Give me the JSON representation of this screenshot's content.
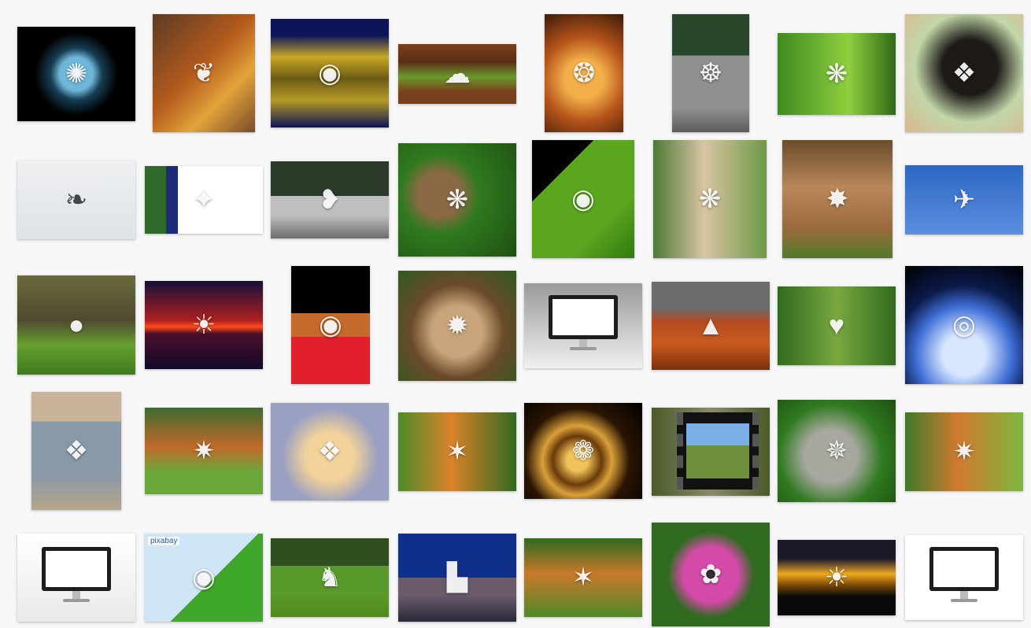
{
  "page": {
    "background": "#f7f7f7"
  },
  "browser_logo_text": "pixabay",
  "tiles": [
    {
      "name": "blue-skull-ornament-thumbnail",
      "icon": "ornament-icon",
      "bg": "radial-gradient(circle at 50% 50%, #6fb7d8 0 22%, #173f55 34%, #000 55%)"
    },
    {
      "name": "autumn-leaves-frame-thumbnail",
      "icon": "leaf-icon",
      "bg": "linear-gradient(135deg,#5b3b23,#b35a1c 45%,#e2a33a 70%,#7a4a2a)"
    },
    {
      "name": "frog-reflection-thumbnail",
      "icon": "frog-icon",
      "bg": "linear-gradient(#0b1457 0 15%, #c9a825 35%, #6b5a15 55%, #b79a26 75%, #0b1457 100%)"
    },
    {
      "name": "lamb-on-grass-thumbnail",
      "icon": "lamb-icon",
      "bg": "linear-gradient(#7a3f1c,#5a2e12 30%, #6a9a2c 55%, #7a3f1c 80%)"
    },
    {
      "name": "fractal-lion-thumbnail",
      "icon": "lion-icon",
      "bg": "radial-gradient(circle at 50% 55%, #f3b04a 0 25%, #b6541a 55%, #3b1a08)"
    },
    {
      "name": "buddha-statue-thumbnail",
      "icon": "statue-icon",
      "bg": "linear-gradient(#27462a 0 35%, #8f8f8f 35% 80%, #5c5c5c)"
    },
    {
      "name": "little-owl-on-rock-thumbnail",
      "icon": "owl-icon",
      "bg": "linear-gradient(90deg,#3f8a1f,#8fcf3f 60%,#2f6a17)"
    },
    {
      "name": "bernese-dog-thumbnail",
      "icon": "dog-icon",
      "bg": "radial-gradient(circle at 55% 45%, #1d1a17 0 30%, #c2d6a8 60%, #d9b88e)"
    },
    {
      "name": "swan-thumbnail",
      "icon": "swan-icon",
      "bg": "linear-gradient(#eef0f2,#dfe3e6)",
      "light": true
    },
    {
      "name": "peacock-thumbnail",
      "icon": "peacock-icon",
      "bg": "linear-gradient(90deg,#2f6a2a 0 18%, #1d2a7a 18% 28%, #ffffff 28%)"
    },
    {
      "name": "ceramic-birds-thumbnail",
      "icon": "bird-icon",
      "bg": "linear-gradient(#2a3b2a 0 45%, #bfbfbf 45% 70%, #6d6d6d)"
    },
    {
      "name": "owl-closeup-thumbnail",
      "icon": "owl-icon",
      "bg": "radial-gradient(circle at 35% 45%, #8a6a44 0 22%, #2f7a1f 40%, #1f4f12)"
    },
    {
      "name": "tree-frog-leaf-thumbnail",
      "icon": "frog-icon",
      "bg": "linear-gradient(135deg,#000 0 28%, #5aa61f 28% 70%, #2f7a0f)"
    },
    {
      "name": "barn-owl-thumbnail",
      "icon": "owl-icon",
      "bg": "linear-gradient(90deg,#4d7a38,#d9c4a2 45%,#6e9a47)"
    },
    {
      "name": "cougar-thumbnail",
      "icon": "cougar-icon",
      "bg": "linear-gradient(#6a4b2a,#b9875a 40%,#9a6b3f 75%,#4f7a26)"
    },
    {
      "name": "seagull-thumbnail",
      "icon": "gull-icon",
      "bg": "linear-gradient(#2e66c2,#5a8fe0)"
    },
    {
      "name": "otter-thumbnail",
      "icon": "otter-icon",
      "bg": "linear-gradient(#6a6a3c,#4f4a2f 45%,#66a02f 70%,#3f7a1f)"
    },
    {
      "name": "red-sunset-sea-thumbnail",
      "icon": "sunset-icon",
      "bg": "linear-gradient(#150f3a,#b01f1f 45%,#ff4a1a 52%,#4a0f2a 60%,#120a2a)"
    },
    {
      "name": "frog-on-flower-thumbnail",
      "icon": "frog-icon",
      "bg": "linear-gradient(#000 0 40%, #c46a2a 40% 60%, #e01f2a 60%)"
    },
    {
      "name": "lynx-thumbnail",
      "icon": "lynx-icon",
      "bg": "radial-gradient(circle at 50% 55%, #c9a37a 0 30%, #6a4a2a 55%, #2f5a1f)"
    },
    {
      "name": "blank-monitor-grey-thumbnail",
      "monitor": true,
      "bg": "linear-gradient(#9a9a9a,#f0f0f0)"
    },
    {
      "name": "monument-valley-thumbnail",
      "icon": "mesa-icon",
      "bg": "linear-gradient(#6c6c6c 0 30%, #b34a1f 45%, #c95a1f 70%, #7a2f0f)"
    },
    {
      "name": "robin-on-branch-thumbnail",
      "icon": "robin-icon",
      "bg": "linear-gradient(90deg,#2f6a1f,#7aa83f 50%,#2f6a1f)"
    },
    {
      "name": "earth-hurricane-thumbnail",
      "icon": "planet-icon",
      "bg": "radial-gradient(circle at 50% 75%, #d7e6ff 0 20%, #3f6fd6 45%, #0a1a4a 65%, #000)"
    },
    {
      "name": "schnauzer-water-thumbnail",
      "icon": "dog-icon",
      "bg": "linear-gradient(#c9b49a 0 25%, #8a99a8 25% 70%, #b6a58a)"
    },
    {
      "name": "fox-grass-thumbnail",
      "icon": "fox-icon",
      "bg": "linear-gradient(#3f6a2f,#c06a2a 45%,#6aa83a 75%)"
    },
    {
      "name": "golden-puppy-thumbnail",
      "icon": "puppy-icon",
      "bg": "radial-gradient(circle at 50% 55%, #f3d29a 0 30%, #9aa0c2 60%)"
    },
    {
      "name": "tiger-roar-thumbnail",
      "icon": "tiger-icon",
      "bg": "linear-gradient(90deg,#4f8a2a,#d9822a 45%,#2f6a1f)"
    },
    {
      "name": "golden-spiral-fractal-thumbnail",
      "icon": "spiral-icon",
      "bg": "radial-gradient(circle at 45% 60%, #f2c25a 0 12%, #6a3a0a 28%, #d9a03a 40%, #2a1402 60%, #000)"
    },
    {
      "name": "film-strip-landscape-thumbnail",
      "film": true,
      "bg": "linear-gradient(90deg,#4a5a2a,#8a8a6a 50%,#4a5a2a)"
    },
    {
      "name": "pallas-cat-thumbnail",
      "icon": "cat-icon",
      "bg": "radial-gradient(circle at 45% 55%, #a8a8a0 0 30%, #2f7a1f 60%, #1f4f12)"
    },
    {
      "name": "fox-sniffing-thumbnail",
      "icon": "fox-icon",
      "bg": "linear-gradient(90deg,#3f7a2a,#d27a2f 45%,#7ab83f)"
    },
    {
      "name": "monitor-website-mug-thumbnail",
      "monitor": true,
      "bg": "linear-gradient(#ffffff,#e9e9e9)",
      "light": true
    },
    {
      "name": "kermit-pixabay-screen-thumbnail",
      "icon": "frog-icon",
      "logo": true,
      "bg": "linear-gradient(135deg,#cfe6f7 0 55%, #3fa82a 55%)"
    },
    {
      "name": "deer-herd-thumbnail",
      "icon": "deer-icon",
      "bg": "linear-gradient(#2f4f1f 0 35%, #5a9a2a 35% 70%, #4f8a1f)"
    },
    {
      "name": "cloud-gate-night-thumbnail",
      "icon": "city-icon",
      "bg": "linear-gradient(#0f2f8a 0 50%, #6a5a6a 50% 70%, #2a2a3a)"
    },
    {
      "name": "tiger-lying-thumbnail",
      "icon": "tiger-icon",
      "bg": "linear-gradient(#2f6a1f,#c9782a 45%,#4f8a2a)"
    },
    {
      "name": "pink-daisy-thumbnail",
      "icon": "flower-icon",
      "bg": "radial-gradient(circle at 50% 50%, #3a2a3a 0 8%, #d44aa8 10% 35%, #2f6a1f 55%)"
    },
    {
      "name": "sunset-city-silhouette-thumbnail",
      "icon": "sunset-icon",
      "bg": "linear-gradient(#1a1a2a 0 25%, #f2a81f 45%, #7a4a0a 60%, #0a0a0a 75%)"
    },
    {
      "name": "blank-monitor-white-thumbnail",
      "monitor": true,
      "bg": "#ffffff",
      "light": true
    }
  ],
  "icon_glyphs": {
    "ornament-icon": "✺",
    "leaf-icon": "❦",
    "frog-icon": "◉",
    "lamb-icon": "☁",
    "lion-icon": "❂",
    "statue-icon": "☸",
    "owl-icon": "❋",
    "dog-icon": "❖",
    "swan-icon": "❧",
    "peacock-icon": "✦",
    "bird-icon": "❥",
    "cougar-icon": "✸",
    "gull-icon": "✈",
    "otter-icon": "●",
    "sunset-icon": "☀",
    "lynx-icon": "✹",
    "mesa-icon": "▲",
    "robin-icon": "♥",
    "planet-icon": "◎",
    "fox-icon": "✷",
    "puppy-icon": "❖",
    "tiger-icon": "✶",
    "spiral-icon": "❁",
    "cat-icon": "✵",
    "deer-icon": "♞",
    "city-icon": "▙",
    "flower-icon": "✿"
  }
}
